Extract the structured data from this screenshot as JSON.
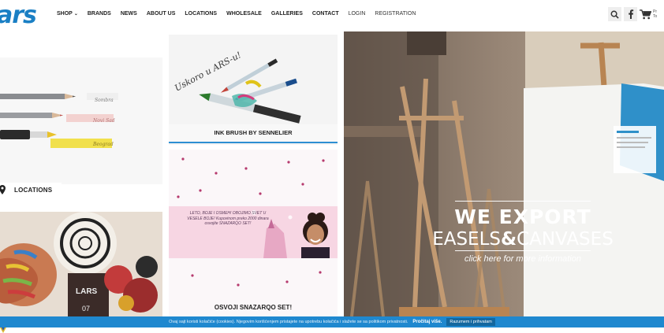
{
  "header": {
    "logo": "ars",
    "nav": [
      {
        "label": "SHOP",
        "caret": "⌄",
        "bold": true
      },
      {
        "label": "BRANDS",
        "bold": true
      },
      {
        "label": "NEWS",
        "bold": true
      },
      {
        "label": "ABOUT US",
        "bold": true
      },
      {
        "label": "LOCATIONS",
        "bold": true
      },
      {
        "label": "WHOLESALE",
        "bold": true
      },
      {
        "label": "GALLERIES",
        "bold": true
      },
      {
        "label": "CONTACT",
        "bold": true
      },
      {
        "label": "LOGIN",
        "bold": false
      },
      {
        "label": "REGISTRATION",
        "bold": false
      }
    ],
    "cart_text": "Pr\nTo"
  },
  "tiles": {
    "pencils": {
      "labels": [
        "Sombra",
        "Novi Sad",
        "Beograd"
      ]
    },
    "locations_label": "LOCATIONS",
    "paint": {
      "text": "LARS",
      "number": "07"
    },
    "inkbrush": {
      "handwriting": "Uskoro u ARS-u!",
      "caption": "INK BRUSH BY SENNELIER"
    },
    "snazarqo": {
      "banner_text": "LETO, BOJE I OSMEH! OBOJIMO SVET U VESELE BOJE! Kupovinom preko 2000 dinara osvojite SNAZARQO SET!",
      "caption": "OSVOJI SNAZARQO SET!"
    }
  },
  "hero": {
    "title_line1": "WE EXPORT",
    "title_line2_a": "EASELS",
    "title_line2_amp": "&",
    "title_line2_b": "CANVASES",
    "cta": "click here for more information"
  },
  "cookie": {
    "message": "Ovaj sajt koristi kolačiće (cookies). Njegovim korišćenjem pristajete na upotrebu kolačića i slažete se sa politikom privatnosti.",
    "accept": "Pročitaj više.",
    "privacy": "Razumem i prihvatam"
  },
  "colors": {
    "brand_blue": "#1a7fc4",
    "cookie_bar": "#1f88cf",
    "accent_underline": "#2d8fd2"
  }
}
